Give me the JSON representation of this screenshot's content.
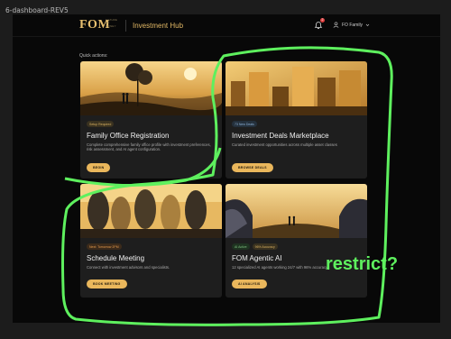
{
  "frame_label": "6-dashboard-REV5",
  "header": {
    "logo_text": "FOM",
    "logo_subtext": [
      "FUTURE",
      "OF",
      "MONEY"
    ],
    "app_title": "Investment Hub",
    "notification_count": "2",
    "user_label": "FO Family"
  },
  "quick_actions_title": "Quick actions:",
  "cards": [
    {
      "title": "Family Office Registration",
      "badges": [
        "Setup Required"
      ],
      "description": "Complete comprehensive family office profile with investment preferences, risk assessment, and AI agent configuration.",
      "button": "BEGIN"
    },
    {
      "title": "Investment Deals Marketplace",
      "badges": [
        "73 New Deals"
      ],
      "description": "Curated investment opportunities across multiple asset classes",
      "button": "BROWSE DEALS"
    },
    {
      "title": "Schedule Meeting",
      "badges": [
        "Next: Tomorrow 2PM"
      ],
      "description": "Connect with investment advisors and specialists.",
      "button": "BOOK MEETING"
    },
    {
      "title": "FOM Agentic AI",
      "badges": [
        "AI Active",
        "96% Accuracy"
      ],
      "description": "12 specialized AI agents working 24/7 with 96% accuracy.",
      "button": "AI ANALYSIS"
    }
  ],
  "annotation": {
    "text": "restrict?",
    "color": "#5ef05e"
  },
  "colors": {
    "accent_gold": "#eab75c",
    "background": "#080808",
    "card": "#1e1e1e"
  }
}
